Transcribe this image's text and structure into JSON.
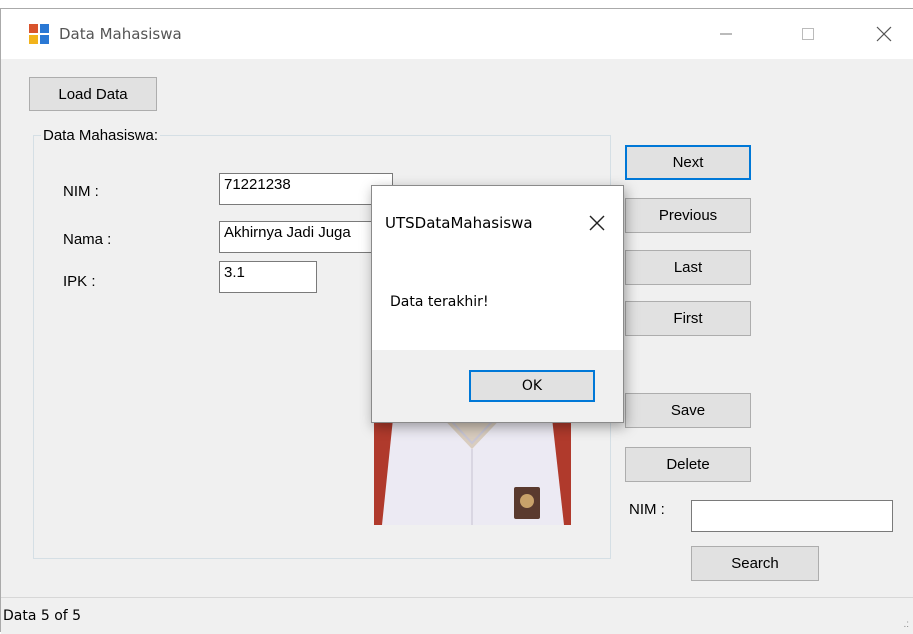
{
  "window": {
    "title": "Data Mahasiswa",
    "icon": "form-icon",
    "controls": [
      "minimize-icon",
      "maximize-icon",
      "close-icon"
    ]
  },
  "toolbar": {
    "load_label": "Load Data"
  },
  "group": {
    "label": "Data Mahasiswa:",
    "nim_label": "NIM :",
    "nim_value": "71221238",
    "nama_label": "Nama :",
    "nama_value": "Akhirnya Jadi Juga",
    "ipk_label": "IPK :",
    "ipk_value": "3.1"
  },
  "nav": {
    "next": "Next",
    "previous": "Previous",
    "last": "Last",
    "first": "First",
    "save": "Save",
    "delete": "Delete"
  },
  "search": {
    "nim_label": "NIM :",
    "value": "",
    "button": "Search"
  },
  "status": {
    "text": "Data  5 of 5",
    "grip": ".:"
  },
  "dialog": {
    "title": "UTSDataMahasiswa",
    "message": "Data terakhir!",
    "ok": "OK"
  },
  "colors": {
    "focus": "#0078d7",
    "button": "#e1e1e1",
    "window_bg": "#f0f0f0"
  }
}
